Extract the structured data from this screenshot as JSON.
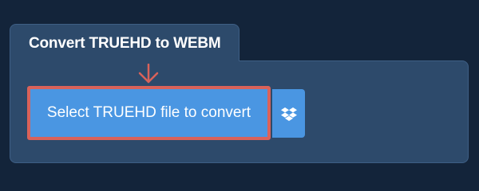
{
  "panel": {
    "title": "Convert TRUEHD to WEBM"
  },
  "actions": {
    "select_label": "Select TRUEHD file to convert",
    "dropbox_icon": "dropbox-icon",
    "pointer_icon": "arrow-down-icon"
  },
  "colors": {
    "background": "#13243a",
    "panel": "#2d4a6b",
    "button": "#4a96e2",
    "highlight": "#d9625a"
  }
}
